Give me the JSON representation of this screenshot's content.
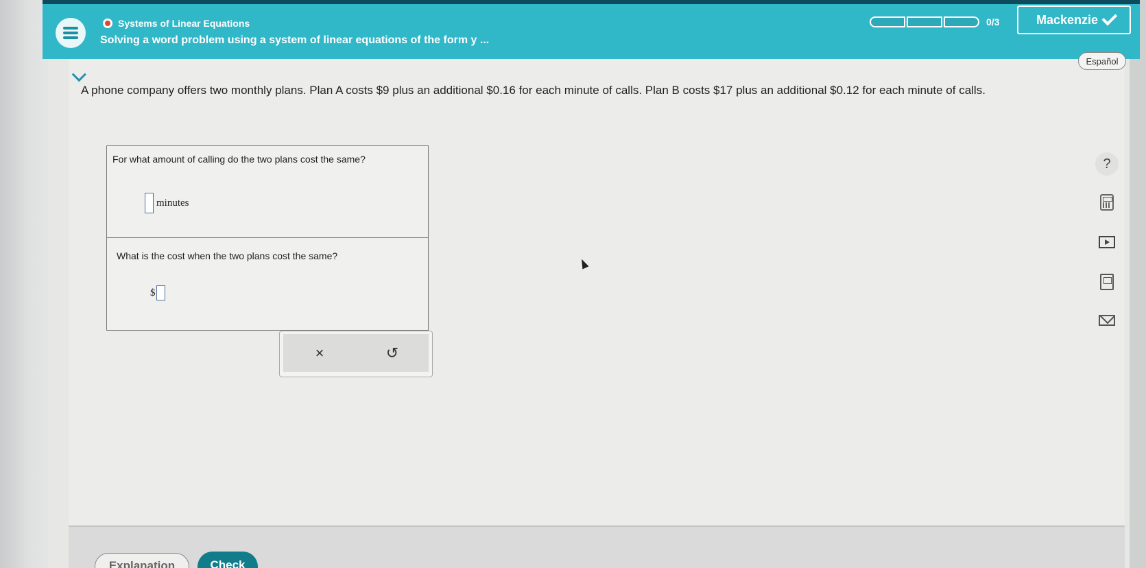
{
  "header": {
    "topic": "Systems of Linear Equations",
    "subtitle": "Solving a word problem using a system of linear equations of the form y ...",
    "progress_text": "0/3",
    "user_name": "Mackenzie"
  },
  "language_button": "Español",
  "problem_text": "A phone company offers two monthly plans. Plan A costs $9 plus an additional $0.16 for each minute of calls. Plan B costs $17 plus an additional $0.12 for each minute of calls.",
  "questions": [
    {
      "prompt": "For what amount of calling do the two plans cost the same?",
      "unit": "minutes",
      "value": ""
    },
    {
      "prompt": "What is the cost when the two plans cost the same?",
      "prefix": "$",
      "value": ""
    }
  ],
  "action_bar": {
    "clear_symbol": "×",
    "undo_symbol": "↺"
  },
  "tools": [
    {
      "icon": "help-icon",
      "label": "?"
    },
    {
      "icon": "calculator-icon"
    },
    {
      "icon": "video-icon"
    },
    {
      "icon": "textbook-icon"
    },
    {
      "icon": "message-icon"
    }
  ],
  "footer": {
    "explanation_label": "Explanation",
    "check_label": "Check"
  },
  "colors": {
    "header_bg": "#30b7c8",
    "check_button": "#117c8a",
    "topic_dot": "#e2452f"
  }
}
